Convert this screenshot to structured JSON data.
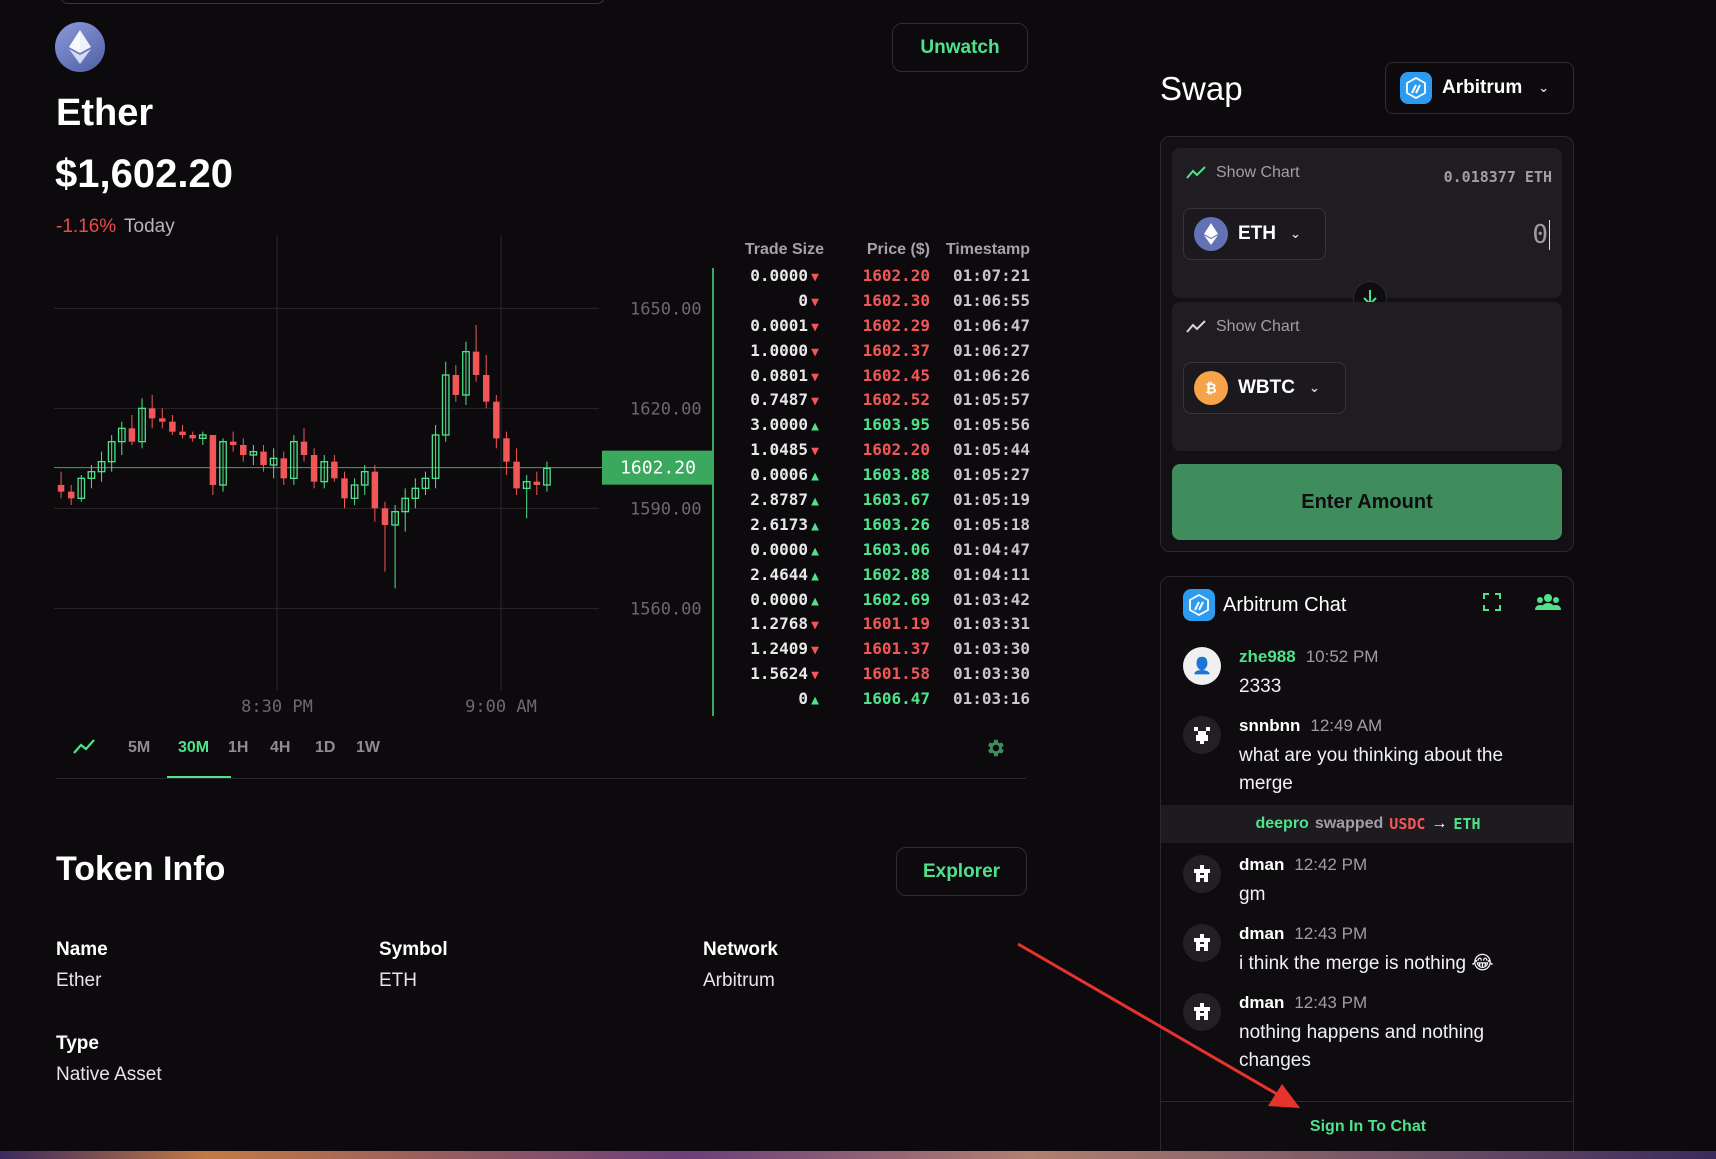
{
  "token": {
    "name": "Ether",
    "price": "$1,602.20",
    "change": "-1.16%",
    "change_period": "Today",
    "watch_label": "Unwatch"
  },
  "chart_data": {
    "type": "candlestick",
    "y_ticks": [
      "1650.00",
      "1620.00",
      "1590.00",
      "1560.00"
    ],
    "x_ticks": [
      "8:30 PM",
      "9:00 AM"
    ],
    "current_price_label": "1602.20",
    "ohlc": [
      [
        1597,
        1601,
        1593,
        1595
      ],
      [
        1595,
        1597,
        1591,
        1593
      ],
      [
        1593,
        1600,
        1592,
        1599
      ],
      [
        1599,
        1603,
        1596,
        1601
      ],
      [
        1601,
        1607,
        1598,
        1604
      ],
      [
        1604,
        1612,
        1601,
        1610
      ],
      [
        1610,
        1616,
        1606,
        1614
      ],
      [
        1614,
        1618,
        1609,
        1610
      ],
      [
        1610,
        1623,
        1608,
        1620
      ],
      [
        1620,
        1624,
        1614,
        1617
      ],
      [
        1617,
        1620,
        1614,
        1616
      ],
      [
        1616,
        1618,
        1612,
        1613
      ],
      [
        1613,
        1615,
        1611,
        1612
      ],
      [
        1612,
        1613,
        1610,
        1611
      ],
      [
        1611,
        1613,
        1609,
        1612
      ],
      [
        1612,
        1612,
        1594,
        1597
      ],
      [
        1597,
        1611,
        1595,
        1610
      ],
      [
        1610,
        1613,
        1607,
        1609
      ],
      [
        1609,
        1611,
        1604,
        1606
      ],
      [
        1606,
        1609,
        1603,
        1607
      ],
      [
        1607,
        1609,
        1601,
        1603
      ],
      [
        1603,
        1608,
        1599,
        1605
      ],
      [
        1605,
        1607,
        1597,
        1599
      ],
      [
        1599,
        1612,
        1597,
        1610
      ],
      [
        1610,
        1614,
        1604,
        1606
      ],
      [
        1606,
        1608,
        1596,
        1598
      ],
      [
        1598,
        1606,
        1596,
        1604
      ],
      [
        1604,
        1606,
        1598,
        1599
      ],
      [
        1599,
        1601,
        1590,
        1593
      ],
      [
        1593,
        1599,
        1591,
        1597
      ],
      [
        1597,
        1603,
        1594,
        1601
      ],
      [
        1601,
        1603,
        1586,
        1590
      ],
      [
        1590,
        1592,
        1571,
        1585
      ],
      [
        1585,
        1591,
        1566,
        1589
      ],
      [
        1589,
        1596,
        1583,
        1593
      ],
      [
        1593,
        1599,
        1590,
        1596
      ],
      [
        1596,
        1601,
        1594,
        1599
      ],
      [
        1599,
        1615,
        1596,
        1612
      ],
      [
        1612,
        1634,
        1610,
        1630
      ],
      [
        1630,
        1633,
        1622,
        1624
      ],
      [
        1624,
        1640,
        1621,
        1637
      ],
      [
        1637,
        1645,
        1628,
        1630
      ],
      [
        1630,
        1636,
        1620,
        1622
      ],
      [
        1622,
        1624,
        1608,
        1611
      ],
      [
        1611,
        1613,
        1600,
        1604
      ],
      [
        1604,
        1608,
        1594,
        1596
      ],
      [
        1596,
        1600,
        1587,
        1598
      ],
      [
        1598,
        1601,
        1594,
        1597
      ],
      [
        1597,
        1604,
        1595,
        1602
      ]
    ]
  },
  "trades": {
    "headers": [
      "Trade Size",
      "Price ($)",
      "Timestamp"
    ],
    "rows": [
      {
        "size": "0.0000",
        "dir": "down",
        "price": "1602.20",
        "time": "01:07:21"
      },
      {
        "size": "0",
        "dir": "down",
        "price": "1602.30",
        "time": "01:06:55"
      },
      {
        "size": "0.0001",
        "dir": "down",
        "price": "1602.29",
        "time": "01:06:47"
      },
      {
        "size": "1.0000",
        "dir": "down",
        "price": "1602.37",
        "time": "01:06:27"
      },
      {
        "size": "0.0801",
        "dir": "down",
        "price": "1602.45",
        "time": "01:06:26"
      },
      {
        "size": "0.7487",
        "dir": "down",
        "price": "1602.52",
        "time": "01:05:57"
      },
      {
        "size": "3.0000",
        "dir": "up",
        "price": "1603.95",
        "time": "01:05:56"
      },
      {
        "size": "1.0485",
        "dir": "down",
        "price": "1602.20",
        "time": "01:05:44"
      },
      {
        "size": "0.0006",
        "dir": "up",
        "price": "1603.88",
        "time": "01:05:27"
      },
      {
        "size": "2.8787",
        "dir": "up",
        "price": "1603.67",
        "time": "01:05:19"
      },
      {
        "size": "2.6173",
        "dir": "up",
        "price": "1603.26",
        "time": "01:05:18"
      },
      {
        "size": "0.0000",
        "dir": "up",
        "price": "1603.06",
        "time": "01:04:47"
      },
      {
        "size": "2.4644",
        "dir": "up",
        "price": "1602.88",
        "time": "01:04:11"
      },
      {
        "size": "0.0000",
        "dir": "up",
        "price": "1602.69",
        "time": "01:03:42"
      },
      {
        "size": "1.2768",
        "dir": "down",
        "price": "1601.19",
        "time": "01:03:31"
      },
      {
        "size": "1.2409",
        "dir": "down",
        "price": "1601.37",
        "time": "01:03:30"
      },
      {
        "size": "1.5624",
        "dir": "down",
        "price": "1601.58",
        "time": "01:03:30"
      },
      {
        "size": "0",
        "dir": "up",
        "price": "1606.47",
        "time": "01:03:16"
      }
    ]
  },
  "timeframes": [
    "5M",
    "30M",
    "1H",
    "4H",
    "1D",
    "1W"
  ],
  "active_timeframe": "30M",
  "token_info": {
    "title": "Token Info",
    "explorer_label": "Explorer",
    "name_label": "Name",
    "name_value": "Ether",
    "symbol_label": "Symbol",
    "symbol_value": "ETH",
    "network_label": "Network",
    "network_value": "Arbitrum",
    "type_label": "Type",
    "type_value": "Native Asset"
  },
  "swap": {
    "title": "Swap",
    "network": "Arbitrum",
    "show_chart": "Show Chart",
    "balance": "0.018377 ETH",
    "from_token": "ETH",
    "from_amount": "0",
    "to_token": "WBTC",
    "button": "Enter Amount"
  },
  "chat": {
    "title": "Arbitrum Chat",
    "messages": [
      {
        "user": "zhe988",
        "time": "10:52 PM",
        "text": "2333"
      },
      {
        "user": "snnbnn",
        "time": "12:49 AM",
        "text": "what are you thinking about the merge"
      },
      {
        "user": "dman",
        "time": "12:42 PM",
        "text": "gm"
      },
      {
        "user": "dman",
        "time": "12:43 PM",
        "text": "i think the merge is nothing 😂"
      },
      {
        "user": "dman",
        "time": "12:43 PM",
        "text": "nothing happens and nothing changes"
      }
    ],
    "swap_event": {
      "user": "deepro",
      "verb": "swapped",
      "from": "USDC",
      "arrow": "→",
      "to": "ETH"
    },
    "sign_in": "Sign In To Chat"
  },
  "colors": {
    "accent": "#4ee38a",
    "down": "#f25757",
    "up_candle": "#4ee38a",
    "down_candle": "#f25757",
    "background": "#0d0a0e"
  }
}
